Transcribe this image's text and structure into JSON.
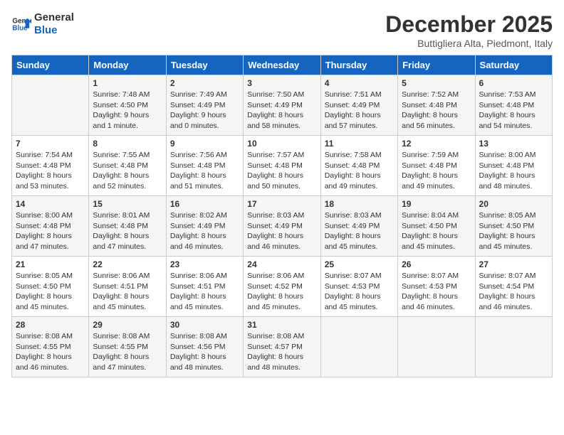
{
  "header": {
    "logo_line1": "General",
    "logo_line2": "Blue",
    "month": "December 2025",
    "location": "Buttigliera Alta, Piedmont, Italy"
  },
  "days_of_week": [
    "Sunday",
    "Monday",
    "Tuesday",
    "Wednesday",
    "Thursday",
    "Friday",
    "Saturday"
  ],
  "weeks": [
    [
      {
        "day": "",
        "info": ""
      },
      {
        "day": "1",
        "info": "Sunrise: 7:48 AM\nSunset: 4:50 PM\nDaylight: 9 hours\nand 1 minute."
      },
      {
        "day": "2",
        "info": "Sunrise: 7:49 AM\nSunset: 4:49 PM\nDaylight: 9 hours\nand 0 minutes."
      },
      {
        "day": "3",
        "info": "Sunrise: 7:50 AM\nSunset: 4:49 PM\nDaylight: 8 hours\nand 58 minutes."
      },
      {
        "day": "4",
        "info": "Sunrise: 7:51 AM\nSunset: 4:49 PM\nDaylight: 8 hours\nand 57 minutes."
      },
      {
        "day": "5",
        "info": "Sunrise: 7:52 AM\nSunset: 4:48 PM\nDaylight: 8 hours\nand 56 minutes."
      },
      {
        "day": "6",
        "info": "Sunrise: 7:53 AM\nSunset: 4:48 PM\nDaylight: 8 hours\nand 54 minutes."
      }
    ],
    [
      {
        "day": "7",
        "info": "Sunrise: 7:54 AM\nSunset: 4:48 PM\nDaylight: 8 hours\nand 53 minutes."
      },
      {
        "day": "8",
        "info": "Sunrise: 7:55 AM\nSunset: 4:48 PM\nDaylight: 8 hours\nand 52 minutes."
      },
      {
        "day": "9",
        "info": "Sunrise: 7:56 AM\nSunset: 4:48 PM\nDaylight: 8 hours\nand 51 minutes."
      },
      {
        "day": "10",
        "info": "Sunrise: 7:57 AM\nSunset: 4:48 PM\nDaylight: 8 hours\nand 50 minutes."
      },
      {
        "day": "11",
        "info": "Sunrise: 7:58 AM\nSunset: 4:48 PM\nDaylight: 8 hours\nand 49 minutes."
      },
      {
        "day": "12",
        "info": "Sunrise: 7:59 AM\nSunset: 4:48 PM\nDaylight: 8 hours\nand 49 minutes."
      },
      {
        "day": "13",
        "info": "Sunrise: 8:00 AM\nSunset: 4:48 PM\nDaylight: 8 hours\nand 48 minutes."
      }
    ],
    [
      {
        "day": "14",
        "info": "Sunrise: 8:00 AM\nSunset: 4:48 PM\nDaylight: 8 hours\nand 47 minutes."
      },
      {
        "day": "15",
        "info": "Sunrise: 8:01 AM\nSunset: 4:48 PM\nDaylight: 8 hours\nand 47 minutes."
      },
      {
        "day": "16",
        "info": "Sunrise: 8:02 AM\nSunset: 4:49 PM\nDaylight: 8 hours\nand 46 minutes."
      },
      {
        "day": "17",
        "info": "Sunrise: 8:03 AM\nSunset: 4:49 PM\nDaylight: 8 hours\nand 46 minutes."
      },
      {
        "day": "18",
        "info": "Sunrise: 8:03 AM\nSunset: 4:49 PM\nDaylight: 8 hours\nand 45 minutes."
      },
      {
        "day": "19",
        "info": "Sunrise: 8:04 AM\nSunset: 4:50 PM\nDaylight: 8 hours\nand 45 minutes."
      },
      {
        "day": "20",
        "info": "Sunrise: 8:05 AM\nSunset: 4:50 PM\nDaylight: 8 hours\nand 45 minutes."
      }
    ],
    [
      {
        "day": "21",
        "info": "Sunrise: 8:05 AM\nSunset: 4:50 PM\nDaylight: 8 hours\nand 45 minutes."
      },
      {
        "day": "22",
        "info": "Sunrise: 8:06 AM\nSunset: 4:51 PM\nDaylight: 8 hours\nand 45 minutes."
      },
      {
        "day": "23",
        "info": "Sunrise: 8:06 AM\nSunset: 4:51 PM\nDaylight: 8 hours\nand 45 minutes."
      },
      {
        "day": "24",
        "info": "Sunrise: 8:06 AM\nSunset: 4:52 PM\nDaylight: 8 hours\nand 45 minutes."
      },
      {
        "day": "25",
        "info": "Sunrise: 8:07 AM\nSunset: 4:53 PM\nDaylight: 8 hours\nand 45 minutes."
      },
      {
        "day": "26",
        "info": "Sunrise: 8:07 AM\nSunset: 4:53 PM\nDaylight: 8 hours\nand 46 minutes."
      },
      {
        "day": "27",
        "info": "Sunrise: 8:07 AM\nSunset: 4:54 PM\nDaylight: 8 hours\nand 46 minutes."
      }
    ],
    [
      {
        "day": "28",
        "info": "Sunrise: 8:08 AM\nSunset: 4:55 PM\nDaylight: 8 hours\nand 46 minutes."
      },
      {
        "day": "29",
        "info": "Sunrise: 8:08 AM\nSunset: 4:55 PM\nDaylight: 8 hours\nand 47 minutes."
      },
      {
        "day": "30",
        "info": "Sunrise: 8:08 AM\nSunset: 4:56 PM\nDaylight: 8 hours\nand 48 minutes."
      },
      {
        "day": "31",
        "info": "Sunrise: 8:08 AM\nSunset: 4:57 PM\nDaylight: 8 hours\nand 48 minutes."
      },
      {
        "day": "",
        "info": ""
      },
      {
        "day": "",
        "info": ""
      },
      {
        "day": "",
        "info": ""
      }
    ]
  ]
}
